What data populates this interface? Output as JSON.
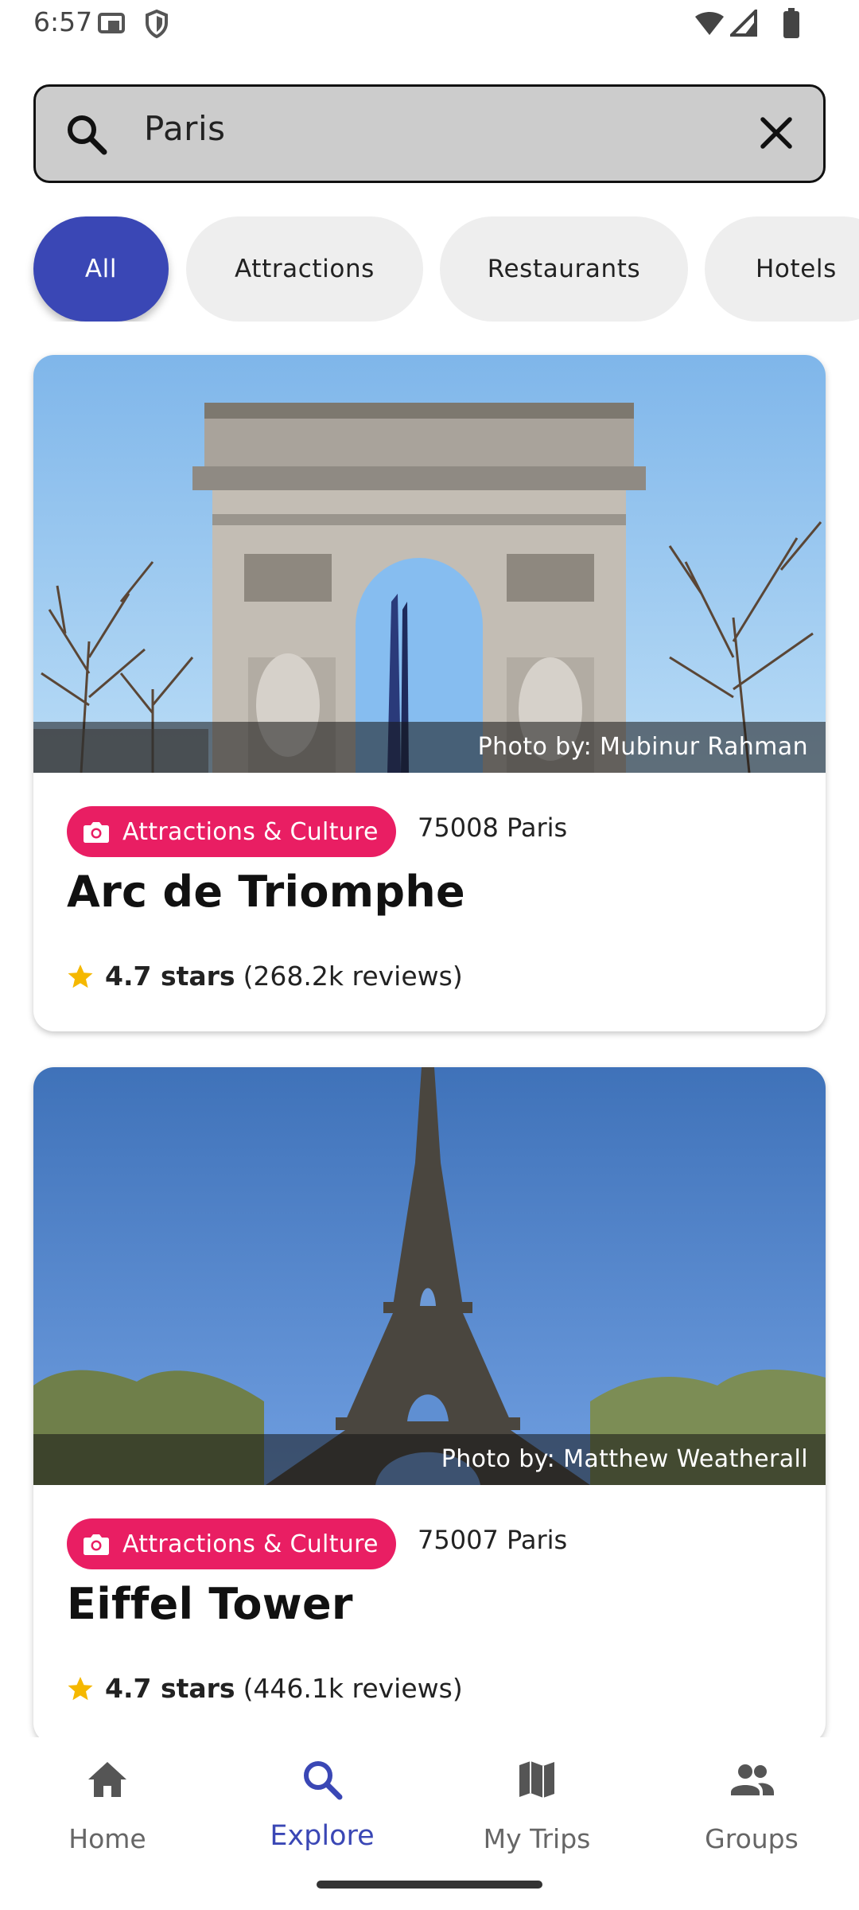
{
  "status_bar": {
    "time": "6:57"
  },
  "search": {
    "value": "Paris"
  },
  "filters": [
    {
      "label": "All",
      "active": true
    },
    {
      "label": "Attractions",
      "active": false
    },
    {
      "label": "Restaurants",
      "active": false
    },
    {
      "label": "Hotels",
      "active": false
    }
  ],
  "cards": [
    {
      "photo_credit": "Photo by: Mubinur Rahman",
      "category": "Attractions & Culture",
      "postal": "75008 Paris",
      "title": "Arc de Triomphe",
      "rating_text": "4.7 stars",
      "reviews_text": "(268.2k reviews)"
    },
    {
      "photo_credit": "Photo by: Matthew Weatherall",
      "category": "Attractions & Culture",
      "postal": "75007 Paris",
      "title": "Eiffel Tower",
      "rating_text": "4.7 stars",
      "reviews_text": "(446.1k reviews)"
    }
  ],
  "bottom_nav": [
    {
      "label": "Home",
      "icon": "home-icon",
      "active": false
    },
    {
      "label": "Explore",
      "icon": "search-icon",
      "active": true
    },
    {
      "label": "My Trips",
      "icon": "map-icon",
      "active": false
    },
    {
      "label": "Groups",
      "icon": "groups-icon",
      "active": false
    }
  ],
  "colors": {
    "accent": "#3a47b5",
    "badge": "#e91e63",
    "star": "#f5b800",
    "search_bg": "#cccccc"
  }
}
